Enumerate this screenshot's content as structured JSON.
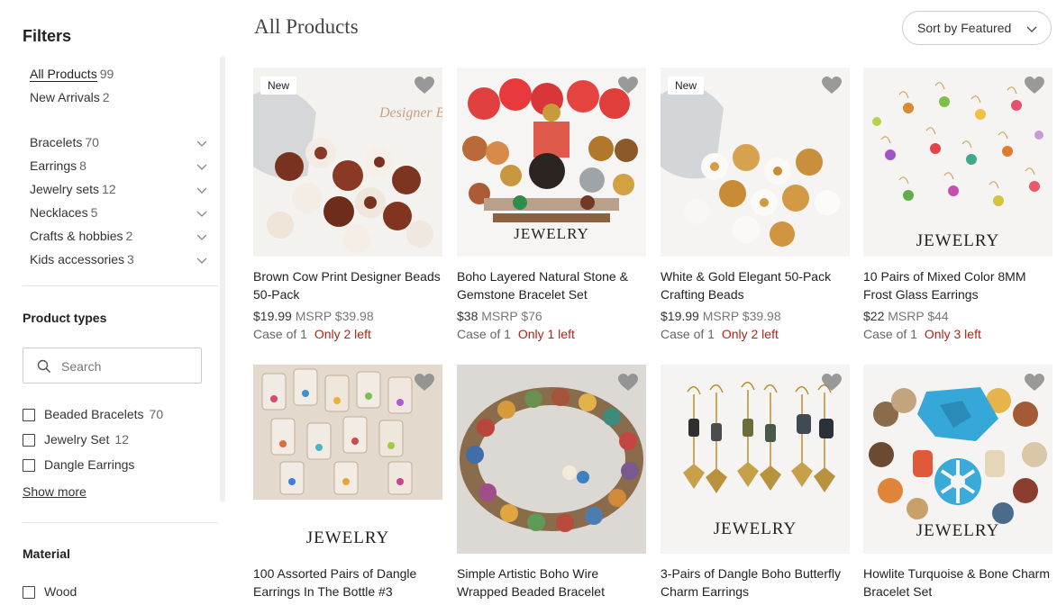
{
  "sidebar": {
    "title": "Filters",
    "categories": [
      {
        "label": "All Products",
        "count": "99"
      },
      {
        "label": "New Arrivals",
        "count": "2"
      },
      {
        "label": "Bracelets",
        "count": "70"
      },
      {
        "label": "Earrings",
        "count": "8"
      },
      {
        "label": "Jewelry sets",
        "count": "12"
      },
      {
        "label": "Necklaces",
        "count": "5"
      },
      {
        "label": "Crafts & hobbies",
        "count": "2"
      },
      {
        "label": "Kids accessories",
        "count": "3"
      }
    ],
    "product_types": {
      "title": "Product types",
      "search_placeholder": "Search",
      "options": [
        {
          "label": "Beaded Bracelets",
          "count": "70"
        },
        {
          "label": "Jewelry Set",
          "count": "12"
        },
        {
          "label": "Dangle Earrings",
          "count": ""
        }
      ],
      "show_more": "Show more"
    },
    "material": {
      "title": "Material",
      "options": [
        {
          "label": "Wood",
          "count": ""
        }
      ]
    }
  },
  "main": {
    "title": "All Products",
    "sort_label": "Sort by Featured"
  },
  "products": [
    {
      "badge": "New",
      "title": "Brown Cow Print Designer Beads 50-Pack",
      "price": "$19.99",
      "msrp": "MSRP $39.98",
      "case": "Case of 1",
      "stock": "Only 2 left",
      "image_text": "Designer Be"
    },
    {
      "badge": "",
      "title": "Boho Layered Natural Stone & Gemstone Bracelet Set",
      "price": "$38",
      "msrp": "MSRP $76",
      "case": "Case of 1",
      "stock": "Only 1 left",
      "image_text": "JEWELRY"
    },
    {
      "badge": "New",
      "title": "White & Gold Elegant 50-Pack Crafting Beads",
      "price": "$19.99",
      "msrp": "MSRP $39.98",
      "case": "Case of 1",
      "stock": "Only 2 left",
      "image_text": ""
    },
    {
      "badge": "",
      "title": "10 Pairs of Mixed Color 8MM Frost Glass Earrings",
      "price": "$22",
      "msrp": "MSRP $44",
      "case": "Case of 1",
      "stock": "Only 3 left",
      "image_text": "JEWELRY"
    },
    {
      "badge": "",
      "title": "100 Assorted Pairs of Dangle Earrings In The Bottle #3",
      "price": "",
      "msrp": "",
      "case": "",
      "stock": "",
      "image_text": "JEWELRY"
    },
    {
      "badge": "",
      "title": "Simple Artistic Boho Wire Wrapped Beaded Bracelet",
      "price": "",
      "msrp": "",
      "case": "",
      "stock": "",
      "image_text": ""
    },
    {
      "badge": "",
      "title": "3-Pairs of Dangle Boho Butterfly Charm Earrings",
      "price": "",
      "msrp": "",
      "case": "",
      "stock": "",
      "image_text": "JEWELRY"
    },
    {
      "badge": "",
      "title": "Howlite Turquoise & Bone Charm Bracelet Set",
      "price": "",
      "msrp": "",
      "case": "",
      "stock": "",
      "image_text": "JEWELRY"
    }
  ]
}
